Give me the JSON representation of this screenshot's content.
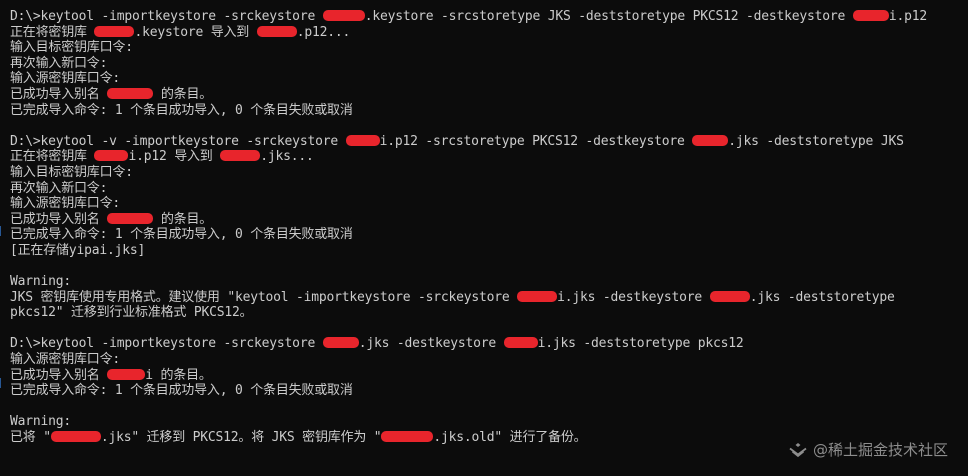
{
  "lines": [
    {
      "segments": [
        "D:\\>keytool -importkeystore -srckeystore ",
        {
          "redact": "w42"
        },
        ".keystore -srcstoretype JKS -deststoretype PKCS12 -destkeystore ",
        {
          "redact": "w36"
        },
        "i.p12"
      ]
    },
    {
      "segments": [
        "正在将密钥库 ",
        {
          "redact": "w40"
        },
        ".keystore 导入到 ",
        {
          "redact": "w40"
        },
        ".p12..."
      ]
    },
    {
      "segments": [
        "输入目标密钥库口令:"
      ]
    },
    {
      "segments": [
        "再次输入新口令:"
      ]
    },
    {
      "segments": [
        "输入源密钥库口令:"
      ]
    },
    {
      "segments": [
        "已成功导入别名 ",
        {
          "redact": "w46"
        },
        " 的条目。"
      ]
    },
    {
      "segments": [
        "已完成导入命令: 1 个条目成功导入, 0 个条目失败或取消"
      ]
    },
    {
      "segments": []
    },
    {
      "segments": [
        "D:\\>keytool -v -importkeystore -srckeystore ",
        {
          "redact": "w34"
        },
        "i.p12 -srcstoretype PKCS12 -destkeystore ",
        {
          "redact": "w36"
        },
        ".jks -deststoretype JKS"
      ]
    },
    {
      "segments": [
        "正在将密钥库 ",
        {
          "redact": "w34"
        },
        "i.p12 导入到 ",
        {
          "redact": "w40"
        },
        ".jks..."
      ]
    },
    {
      "segments": [
        "输入目标密钥库口令:"
      ]
    },
    {
      "segments": [
        "再次输入新口令:"
      ]
    },
    {
      "segments": [
        "输入源密钥库口令:"
      ]
    },
    {
      "segments": [
        "已成功导入别名 ",
        {
          "redact": "w46"
        },
        " 的条目。"
      ]
    },
    {
      "segments": [
        "已完成导入命令: 1 个条目成功导入, 0 个条目失败或取消"
      ]
    },
    {
      "segments": [
        "[正在存储yipai.jks]"
      ]
    },
    {
      "segments": []
    },
    {
      "segments": [
        "Warning:"
      ]
    },
    {
      "segments": [
        "JKS 密钥库使用专用格式。建议使用 \"keytool -importkeystore -srckeystore ",
        {
          "redact": "w40"
        },
        "i.jks -destkeystore ",
        {
          "redact": "w40"
        },
        ".jks -deststoretype"
      ]
    },
    {
      "segments": [
        "pkcs12\" 迁移到行业标准格式 PKCS12。"
      ]
    },
    {
      "segments": []
    },
    {
      "segments": [
        "D:\\>keytool -importkeystore -srckeystore ",
        {
          "redact": "w36"
        },
        ".jks -destkeystore ",
        {
          "redact": "w34"
        },
        "i.jks -deststoretype pkcs12"
      ]
    },
    {
      "segments": [
        "输入源密钥库口令:"
      ]
    },
    {
      "segments": [
        "已成功导入别名 ",
        {
          "redact": "w38"
        },
        "i 的条目。"
      ]
    },
    {
      "segments": [
        "已完成导入命令: 1 个条目成功导入, 0 个条目失败或取消"
      ]
    },
    {
      "segments": []
    },
    {
      "segments": [
        "Warning:"
      ]
    },
    {
      "segments": [
        "已将 \"",
        {
          "redact": "w50"
        },
        ".jks\" 迁移到 PKCS12。将 JKS 密钥库作为 \"",
        {
          "redact": "w52"
        },
        ".jks.old\" 进行了备份。"
      ]
    }
  ],
  "watermark": {
    "text": "@稀土掘金技术社区",
    "icon": "juejin-logo-icon"
  },
  "colors": {
    "background": "#0c0c0c",
    "text": "#cccccc",
    "redaction": "#e8252c",
    "watermark": "#8d8d8d"
  }
}
